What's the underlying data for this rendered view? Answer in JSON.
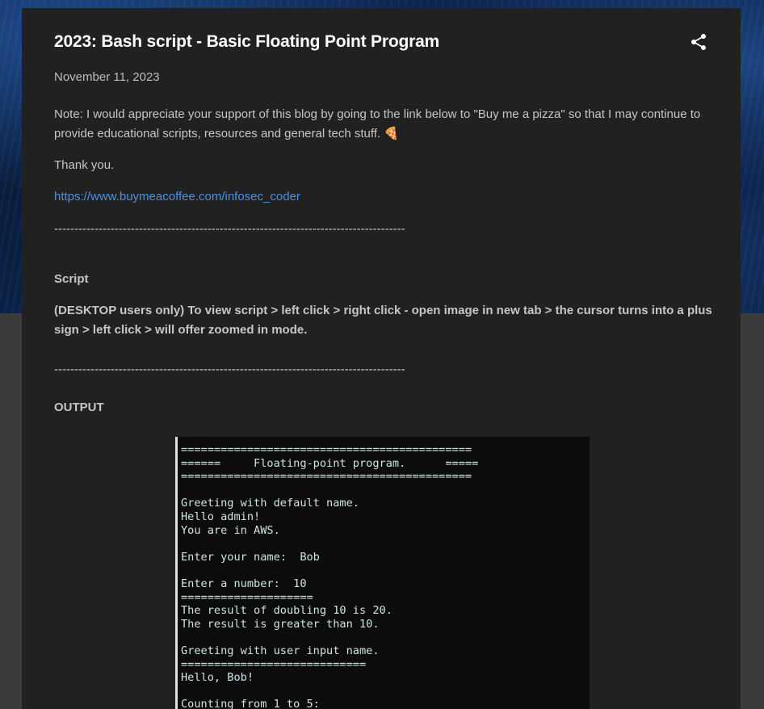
{
  "post": {
    "title": "2023: Bash script - Basic Floating Point Program",
    "date": "November 11, 2023",
    "share_icon": "share-icon",
    "note": " Note: I would appreciate your support of this blog by going to the link below to \"Buy me a pizza\" so that I may continue to provide educational scripts, resources and general tech stuff. ",
    "pizza_emoji": "🍕",
    "thanks": "Thank you.",
    "link": "https://www.buymeacoffee.com/infosec_coder",
    "separator": "---------------------------------------------------------------------------------------",
    "script_heading": "Script",
    "desktop_instructions": "(DESKTOP users only) To view script > left click > right click - open image in new tab > the cursor turns into a plus sign > left click > will offer zoomed in mode.",
    "output_heading": "OUTPUT"
  },
  "terminal": {
    "lines": [
      "============================================",
      "======     Floating-point program.      =====",
      "============================================",
      "",
      "Greeting with default name.",
      "Hello admin!",
      "You are in AWS.",
      "",
      "Enter your name:  Bob",
      "",
      "Enter a number:  10",
      "====================",
      "The result of doubling 10 is 20.",
      "The result is greater than 10.",
      "",
      "Greeting with user input name.",
      "============================",
      "Hello, Bob!",
      "",
      "Counting from 1 to 5:"
    ]
  },
  "colors": {
    "page_background": "#3b3b3b",
    "card_background": "#212121",
    "link": "#4a90e2",
    "terminal_background": "#0c0c0c",
    "terminal_text": "#cfe3e3"
  }
}
